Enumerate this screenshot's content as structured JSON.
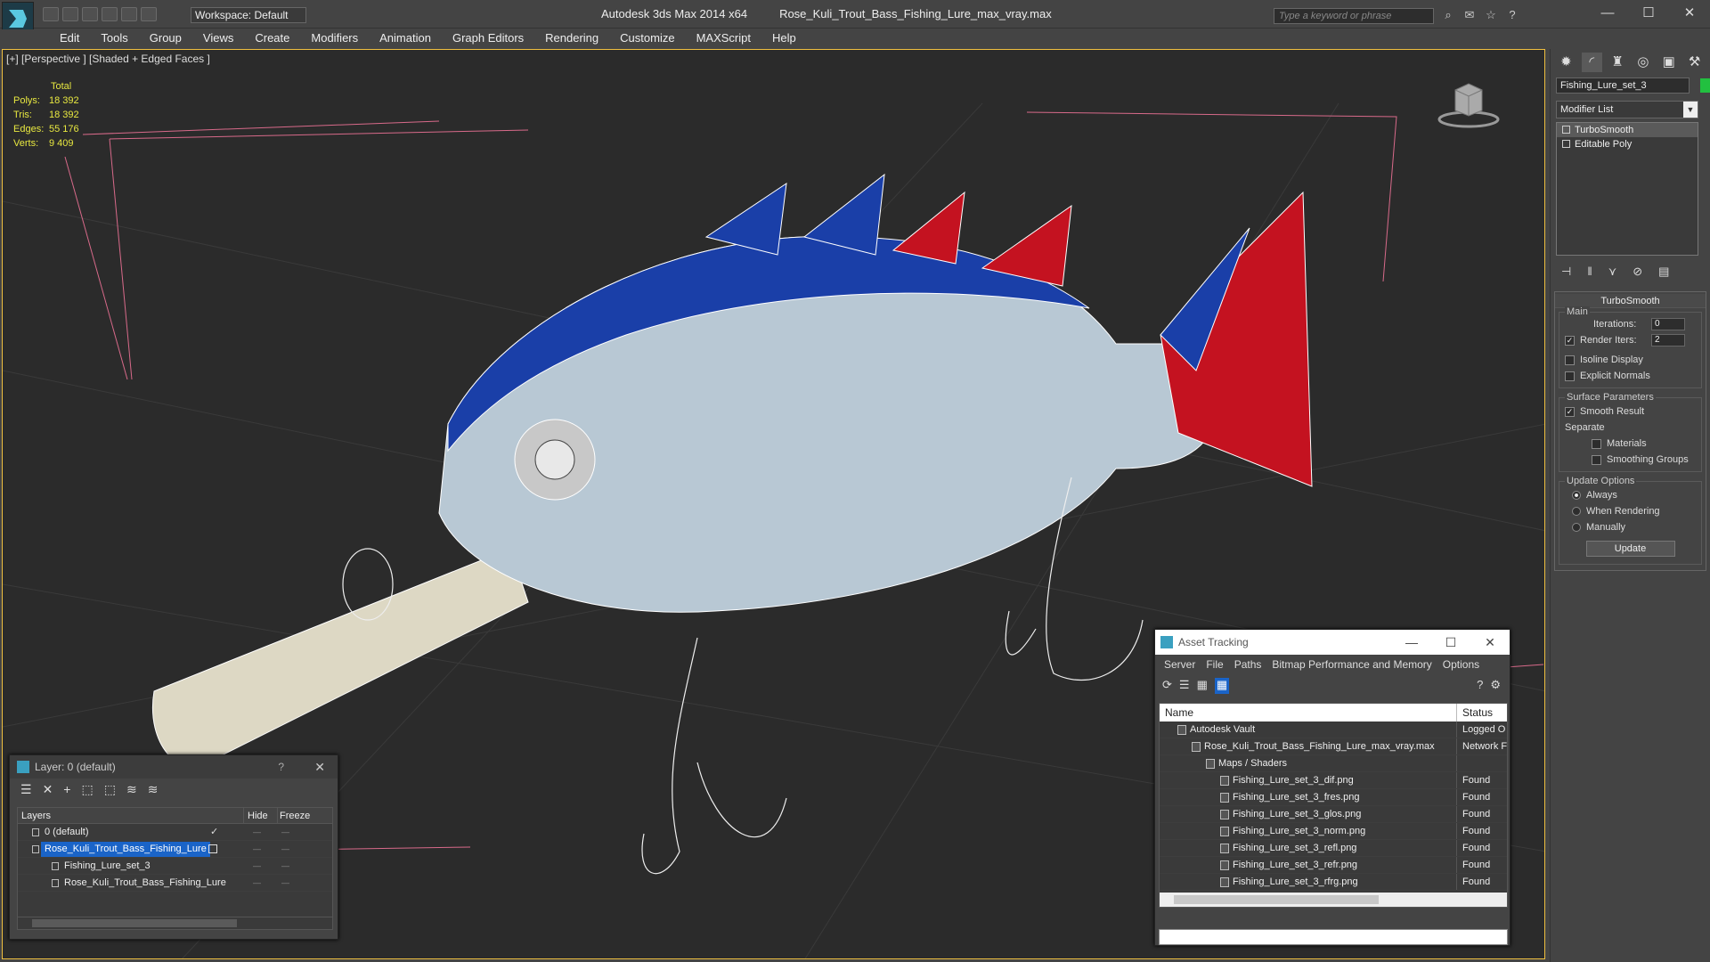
{
  "app": {
    "name": "Autodesk 3ds Max  2014 x64",
    "file": "Rose_Kuli_Trout_Bass_Fishing_Lure_max_vray.max",
    "workspace": "Workspace: Default",
    "search_placeholder": "Type a keyword or phrase"
  },
  "menu": [
    "Edit",
    "Tools",
    "Group",
    "Views",
    "Create",
    "Modifiers",
    "Animation",
    "Graph Editors",
    "Rendering",
    "Customize",
    "MAXScript",
    "Help"
  ],
  "viewport": {
    "label": "[+] [Perspective ] [Shaded + Edged Faces ]",
    "stats": {
      "header": "Total",
      "rows": [
        {
          "k": "Polys:",
          "v": "18 392"
        },
        {
          "k": "Tris:",
          "v": "18 392"
        },
        {
          "k": "Edges:",
          "v": "55 176"
        },
        {
          "k": "Verts:",
          "v": "9 409"
        }
      ]
    },
    "colors": {
      "body_blue": "#1a3fa8",
      "fin_red": "#c41220",
      "lip": "#ddd8c4",
      "background": "#2b2b2b"
    }
  },
  "command_panel": {
    "object_name": "Fishing_Lure_set_3",
    "modifier_list": "Modifier List",
    "stack": [
      "TurboSmooth",
      "Editable Poly"
    ],
    "rollout_title": "TurboSmooth",
    "main": {
      "title": "Main",
      "iterations_label": "Iterations:",
      "iterations": "0",
      "render_iters_label": "Render Iters:",
      "render_iters": "2",
      "isoline": "Isoline Display",
      "explicit": "Explicit Normals"
    },
    "surface": {
      "title": "Surface Parameters",
      "smooth": "Smooth Result",
      "separate": "Separate",
      "materials": "Materials",
      "smoothing_groups": "Smoothing Groups"
    },
    "update": {
      "title": "Update Options",
      "always": "Always",
      "when_rendering": "When Rendering",
      "manually": "Manually",
      "button": "Update"
    }
  },
  "layer_window": {
    "title": "Layer: 0 (default)",
    "help": "?",
    "columns": {
      "layers": "Layers",
      "hide": "Hide",
      "freeze": "Freeze"
    },
    "rows": [
      {
        "name": "0 (default)",
        "indent": 16
      },
      {
        "name": "Rose_Kuli_Trout_Bass_Fishing_Lure",
        "indent": 16
      },
      {
        "name": "Fishing_Lure_set_3",
        "indent": 38
      },
      {
        "name": "Rose_Kuli_Trout_Bass_Fishing_Lure",
        "indent": 38
      }
    ]
  },
  "asset_window": {
    "title": "Asset Tracking",
    "menu": [
      "Server",
      "File",
      "Paths",
      "Bitmap Performance and Memory",
      "Options"
    ],
    "columns": {
      "name": "Name",
      "status": "Status"
    },
    "rows": [
      {
        "name": "Autodesk Vault",
        "status": "Logged O",
        "indent": 20
      },
      {
        "name": "Rose_Kuli_Trout_Bass_Fishing_Lure_max_vray.max",
        "status": "Network F",
        "indent": 36
      },
      {
        "name": "Maps / Shaders",
        "status": "",
        "indent": 52
      },
      {
        "name": "Fishing_Lure_set_3_dif.png",
        "status": "Found",
        "indent": 68
      },
      {
        "name": "Fishing_Lure_set_3_fres.png",
        "status": "Found",
        "indent": 68
      },
      {
        "name": "Fishing_Lure_set_3_glos.png",
        "status": "Found",
        "indent": 68
      },
      {
        "name": "Fishing_Lure_set_3_norm.png",
        "status": "Found",
        "indent": 68
      },
      {
        "name": "Fishing_Lure_set_3_refl.png",
        "status": "Found",
        "indent": 68
      },
      {
        "name": "Fishing_Lure_set_3_refr.png",
        "status": "Found",
        "indent": 68
      },
      {
        "name": "Fishing_Lure_set_3_rfrg.png",
        "status": "Found",
        "indent": 68
      }
    ]
  }
}
